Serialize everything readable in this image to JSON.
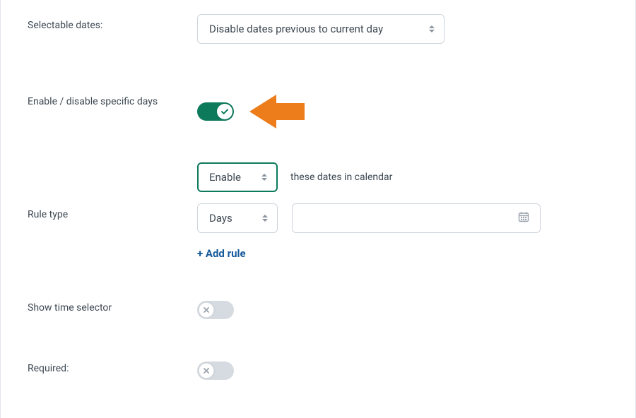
{
  "selectable_dates": {
    "label": "Selectable dates:",
    "value": "Disable dates previous to current day"
  },
  "enable_specific": {
    "label": "Enable / disable specific days",
    "toggle_on": true
  },
  "rule": {
    "action_value": "Enable",
    "helper": "these dates in calendar"
  },
  "rule_type": {
    "label": "Rule type",
    "value": "Days"
  },
  "add_rule_label": "+ Add rule",
  "show_time": {
    "label": "Show time selector",
    "toggle_on": false
  },
  "required": {
    "label": "Required:",
    "toggle_on": false
  }
}
